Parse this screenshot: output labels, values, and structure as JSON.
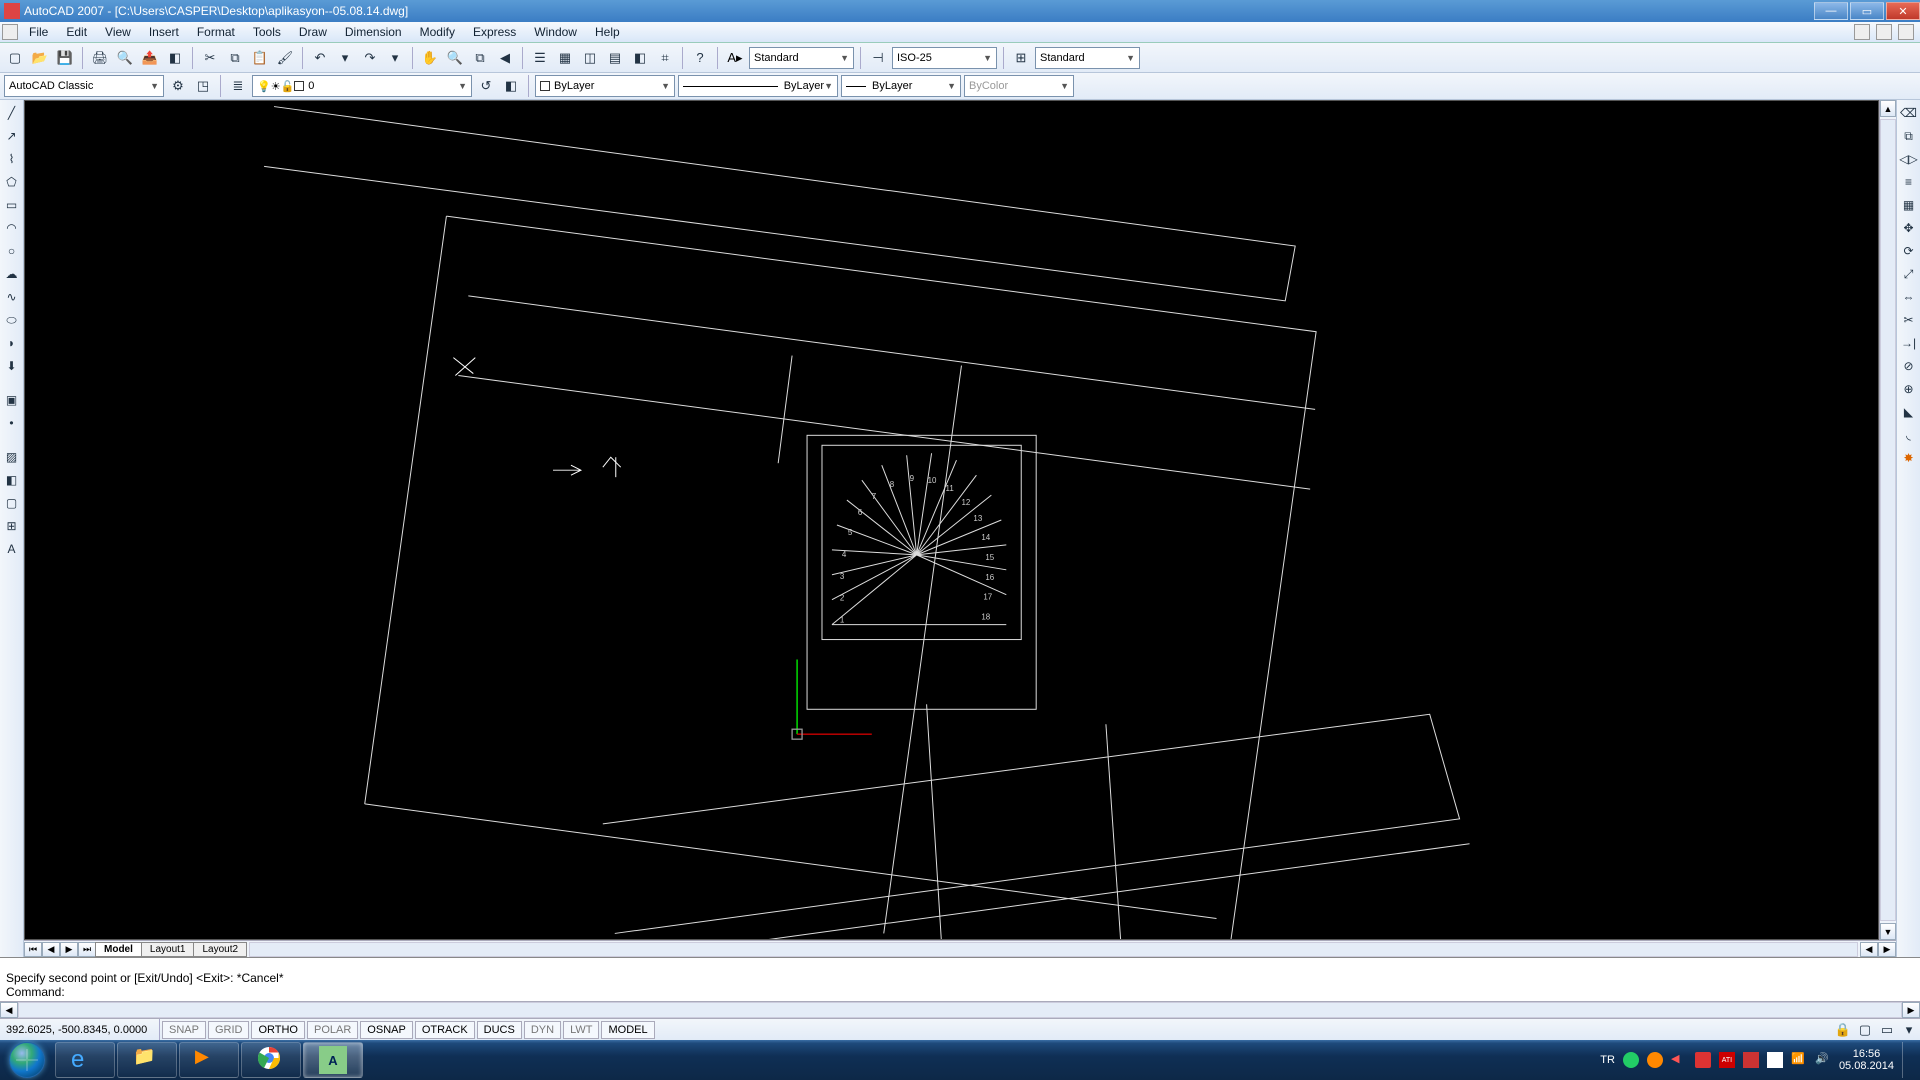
{
  "titlebar": {
    "title": "AutoCAD 2007 - [C:\\Users\\CASPER\\Desktop\\aplikasyon--05.08.14.dwg]"
  },
  "menu": [
    "File",
    "Edit",
    "View",
    "Insert",
    "Format",
    "Tools",
    "Draw",
    "Dimension",
    "Modify",
    "Express",
    "Window",
    "Help"
  ],
  "styles": {
    "text_style": "Standard",
    "dim_style": "ISO-25",
    "table_style": "Standard"
  },
  "workspace": "AutoCAD Classic",
  "layer": {
    "current": "0",
    "color_control": "ByLayer",
    "linetype_control": "ByLayer",
    "lineweight_control": "ByLayer",
    "plot_style": "ByColor"
  },
  "tabs": {
    "model": "Model",
    "layouts": [
      "Layout1",
      "Layout2"
    ]
  },
  "command": {
    "line1": "Specify second point or [Exit/Undo] <Exit>: *Cancel*",
    "prompt": "Command:"
  },
  "status": {
    "coords": "392.6025, -500.8345, 0.0000",
    "toggles": [
      "SNAP",
      "GRID",
      "ORTHO",
      "POLAR",
      "OSNAP",
      "OTRACK",
      "DUCS",
      "DYN",
      "LWT",
      "MODEL"
    ]
  },
  "taskbar": {
    "lang": "TR",
    "time": "16:56",
    "date": "05.08.2014"
  },
  "stair_numbers": [
    "1",
    "2",
    "3",
    "4",
    "5",
    "6",
    "7",
    "8",
    "9",
    "10",
    "11",
    "12",
    "13",
    "14",
    "15",
    "16",
    "17",
    "18"
  ]
}
